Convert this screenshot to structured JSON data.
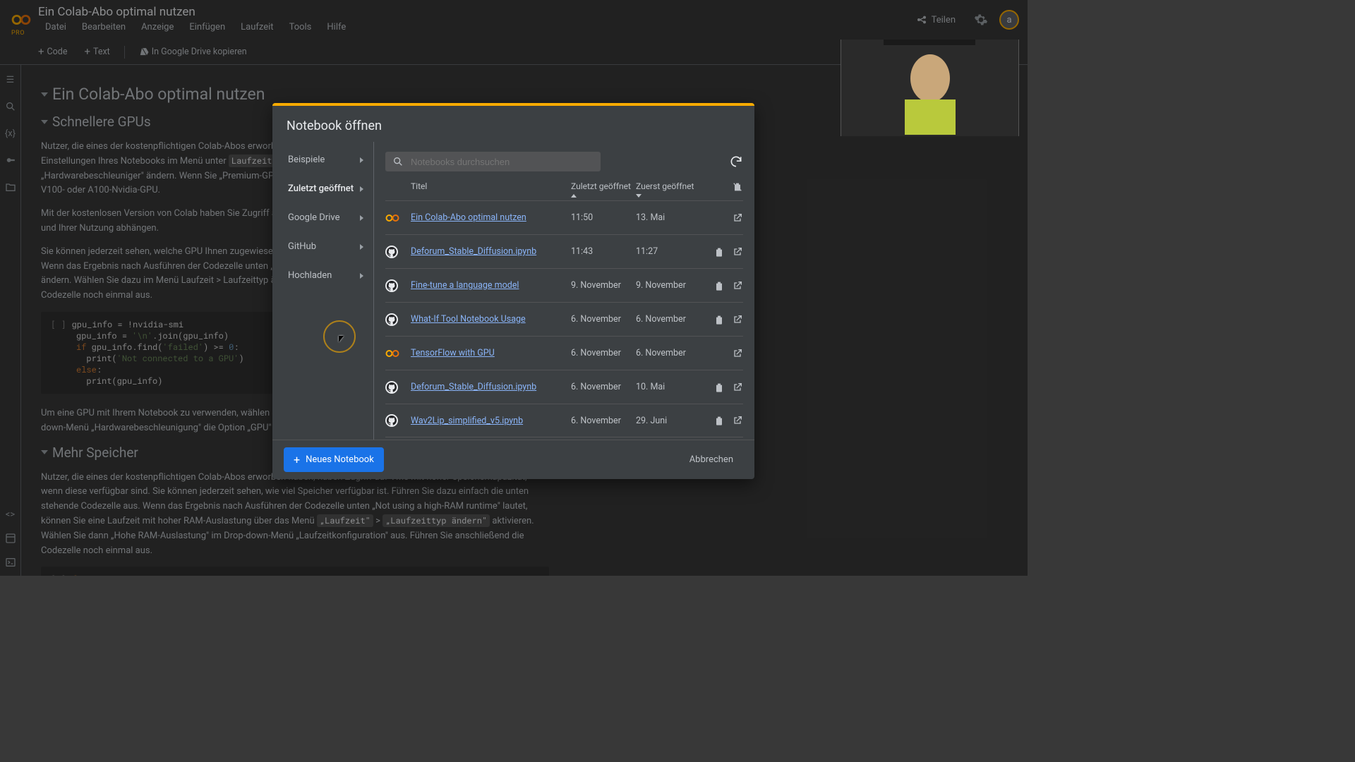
{
  "header": {
    "pro_label": "PRO",
    "doc_title": "Ein Colab-Abo optimal nutzen",
    "menu": [
      "Datei",
      "Bearbeiten",
      "Anzeige",
      "Einfügen",
      "Laufzeit",
      "Tools",
      "Hilfe"
    ],
    "share_label": "Teilen",
    "avatar_initial": "a"
  },
  "toolbar": {
    "code_btn": "Code",
    "text_btn": "Text",
    "copy_drive": "In Google Drive kopieren"
  },
  "doc": {
    "h1": "Ein Colab-Abo optimal nutzen",
    "h2a": "Schnellere GPUs",
    "p1_a": "Nutzer, die eines der kostenpflichtigen Colab-Abos erworben haben, haben Zugriff auf Premium-GPUs. Sie können die GPU-Einstellungen Ihres Notebooks im Menü unter ",
    "kbd1": "Laufzeit > Laufzeittyp ändern",
    "p1_b": " mithilfe des Drop-down-Menüs „Hardwarebeschleuniger\" ändern. Wenn Sie „Premium-GPU\" auswählen, erhalten Sie je nach Verfügbarkeit Zugriff auf eine V100- oder A100-Nvidia-GPU.",
    "p2": "Mit der kostenlosen Version von Colab haben Sie Zugriff auf die K80-GPUs von Nvidia. Dies kann allerdings von Verfügbarkeit und Ihrer Nutzung abhängen.",
    "p3": "Sie können jederzeit sehen, welche GPU Ihnen zugewiesen wurde. Führen Sie dazu einfach die unten stehende Zelle aus. Wenn das Ergebnis nach Ausführen der Codezelle unten „Not connected to a GPU\" lautet, dann können Sie die Laufzeit ändern. Wählen Sie dazu im Menü Laufzeit > Laufzeittyp ändern aus, um einen GPU-Beschleuniger zu aktivieren, und dann die Codezelle noch einmal aus.",
    "p4": "Um eine GPU mit Ihrem Notebook zu verwenden, wählen Sie die Menüoption Laufzeit > Laufzeittyp ändern und dann im Drop-down-Menü „Hardwarebeschleunigung\" die Option „GPU\" aus.",
    "h2b": "Mehr Speicher",
    "p5_a": "Nutzer, die eines der kostenpflichtigen Colab-Abos erworben haben, haben Zugriff auf VMs mit hoher Speicherkapazität, wenn diese verfügbar sind. Sie können jederzeit sehen, wie viel Speicher verfügbar ist. Führen Sie dazu einfach die unten stehende Codezelle aus. Wenn das Ergebnis nach Ausführen der Codezelle unten „Not using a high-RAM runtime\" lautet, können Sie eine Laufzeit mit hoher RAM-Auslastung über das Menü ",
    "kbd2a": "„Laufzeit\"",
    "p5_b": " > ",
    "kbd2b": "„Laufzeittyp ändern\"",
    "p5_c": " aktivieren. Wählen Sie dann „Hohe RAM-Auslastung\" im Drop-down-Menü „Laufzeitkonfiguration\" aus. Führen Sie anschließend die Codezelle noch einmal aus."
  },
  "dialog": {
    "title": "Notebook öffnen",
    "left": {
      "examples": "Beispiele",
      "recent": "Zuletzt geöffnet",
      "drive": "Google Drive",
      "github": "GitHub",
      "upload": "Hochladen"
    },
    "search_placeholder": "Notebooks durchsuchen",
    "cols": {
      "title": "Titel",
      "last": "Zuletzt geöffnet",
      "first": "Zuerst geöffnet"
    },
    "rows": [
      {
        "icon": "colab",
        "title": "Ein Colab-Abo optimal nutzen",
        "last": "11:50",
        "first": "13. Mai",
        "trash": false
      },
      {
        "icon": "github",
        "title": "Deforum_Stable_Diffusion.ipynb",
        "last": "11:43",
        "first": "11:27",
        "trash": true
      },
      {
        "icon": "github",
        "title": "Fine-tune a language model",
        "last": "9. November",
        "first": "9. November",
        "trash": true
      },
      {
        "icon": "github",
        "title": "What-If Tool Notebook Usage",
        "last": "6. November",
        "first": "6. November",
        "trash": true
      },
      {
        "icon": "colab",
        "title": "TensorFlow with GPU",
        "last": "6. November",
        "first": "6. November",
        "trash": false
      },
      {
        "icon": "github",
        "title": "Deforum_Stable_Diffusion.ipynb",
        "last": "6. November",
        "first": "10. Mai",
        "trash": true
      },
      {
        "icon": "github",
        "title": "Wav2Lip_simplified_v5.ipynb",
        "last": "6. November",
        "first": "29. Juni",
        "trash": true
      }
    ],
    "new_nb": "Neues Notebook",
    "cancel": "Abbrechen"
  }
}
